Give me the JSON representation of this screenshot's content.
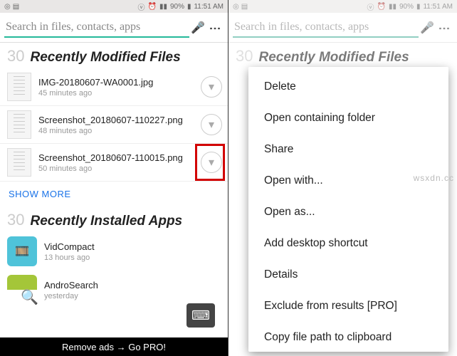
{
  "status_bar": {
    "time": "11:51 AM",
    "battery_pct": "90%",
    "signal": "▮▮",
    "alarm_icon": "⏰",
    "vibrate_icon": "📳"
  },
  "search": {
    "placeholder": "Search in files, contacts, apps"
  },
  "sections": {
    "recent_files": {
      "count": "30",
      "title": "Recently Modified Files",
      "items": [
        {
          "name": "IMG-20180607-WA0001.jpg",
          "time": "45 minutes ago"
        },
        {
          "name": "Screenshot_20180607-110227.png",
          "time": "48 minutes ago"
        },
        {
          "name": "Screenshot_20180607-110015.png",
          "time": "50 minutes ago"
        }
      ],
      "show_more": "SHOW MORE"
    },
    "recent_apps": {
      "count": "30",
      "title": "Recently Installed Apps",
      "items": [
        {
          "name": "VidCompact",
          "time": "13 hours ago"
        },
        {
          "name": "AndroSearch",
          "time": "yesterday"
        }
      ]
    }
  },
  "ad_bar": "Remove ads → Go PRO!",
  "context_menu": {
    "items": [
      "Delete",
      "Open containing folder",
      "Share",
      "Open with...",
      "Open as...",
      "Add desktop shortcut",
      "Details",
      "Exclude from results [PRO]",
      "Copy file path to clipboard"
    ]
  },
  "watermark": "wsxdn.cc"
}
